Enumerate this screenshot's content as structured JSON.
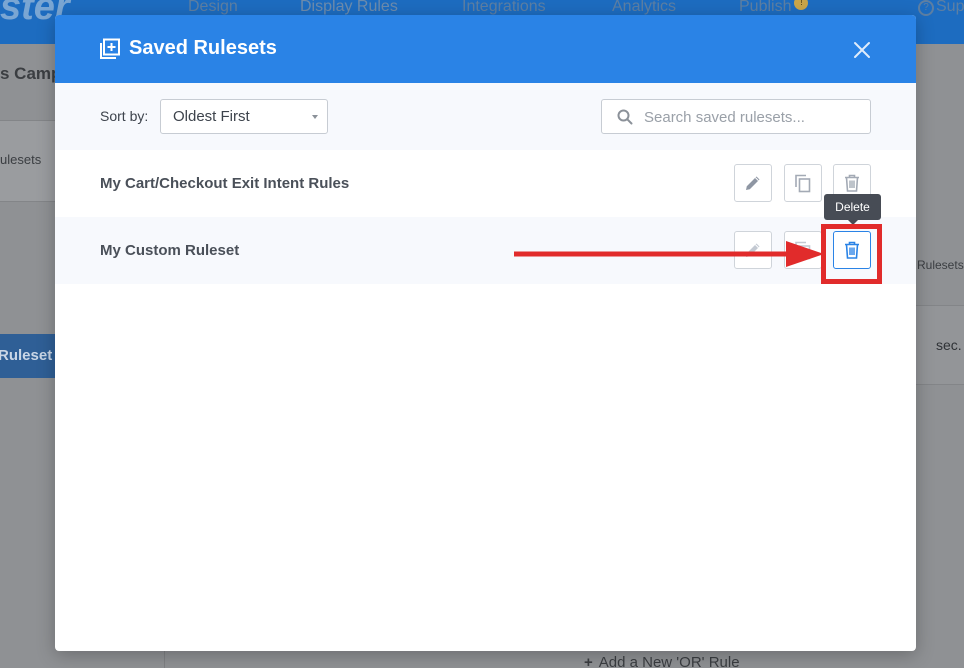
{
  "background": {
    "logo": "ster",
    "nav": [
      "Design",
      "Display Rules",
      "Integrations",
      "Analytics",
      "Publish"
    ],
    "publish_badge": "!",
    "help": "Sup",
    "campaign_fragment": "s Camp",
    "rulesets_fragment": "ulesets",
    "ruleset_button_fragment": "Ruleset",
    "right_ruleset_fragment": "Rulesets",
    "right_sec_fragment": "sec.",
    "add_rule": "Add a New 'OR' Rule"
  },
  "modal": {
    "title": "Saved Rulesets",
    "sort": {
      "label": "Sort by:",
      "value": "Oldest First"
    },
    "search": {
      "placeholder": "Search saved rulesets...",
      "value": ""
    },
    "rulesets": [
      {
        "name": "My Cart/Checkout Exit Intent Rules"
      },
      {
        "name": "My Custom Ruleset"
      }
    ],
    "tooltip": "Delete"
  },
  "colors": {
    "header_blue": "#2a83e6",
    "annotation_red": "#e12b2b",
    "tooltip_bg": "#474c55"
  },
  "icons": [
    "saved-rulesets-icon",
    "close-icon",
    "search-icon",
    "pencil-icon",
    "copy-icon",
    "trash-icon",
    "help-icon"
  ]
}
